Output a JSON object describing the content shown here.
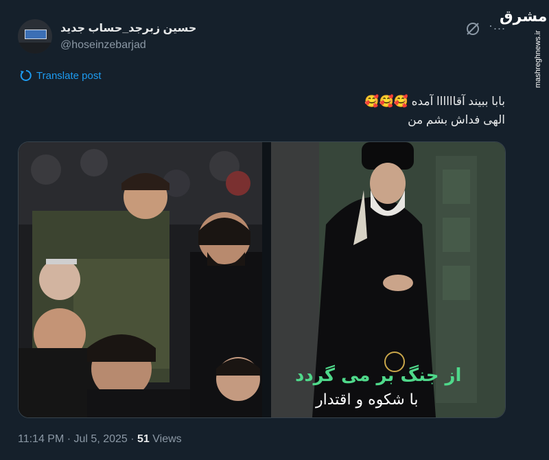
{
  "author": {
    "display_name": "حسین زبرجد_حساب جدید",
    "handle": "@hoseinzebarjad"
  },
  "icons": {
    "grok": "grok-icon",
    "more": "more-icon",
    "translate": "translate-icon"
  },
  "more_glyph": "·...",
  "watermark": {
    "logo": "مشرق",
    "url": "mashreghnews.ir"
  },
  "translate_label": "Translate post",
  "tweet": {
    "line1": "بابا ببیند آقاااااا آمده 🥰🥰🥰",
    "line2": "الهی فداش بشم من"
  },
  "media": {
    "poster_title": "از جنگ بر می گردد",
    "poster_subtitle": "با شکوه و اقتدار"
  },
  "meta": {
    "time": "11:14 PM",
    "separator": " · ",
    "date": "Jul 5, 2025",
    "views_count": "51",
    "views_label": "Views"
  },
  "colors": {
    "background": "#15202b",
    "link": "#1d9bf0",
    "secondary_text": "#8b98a5",
    "poster_green": "#4fd88a"
  }
}
